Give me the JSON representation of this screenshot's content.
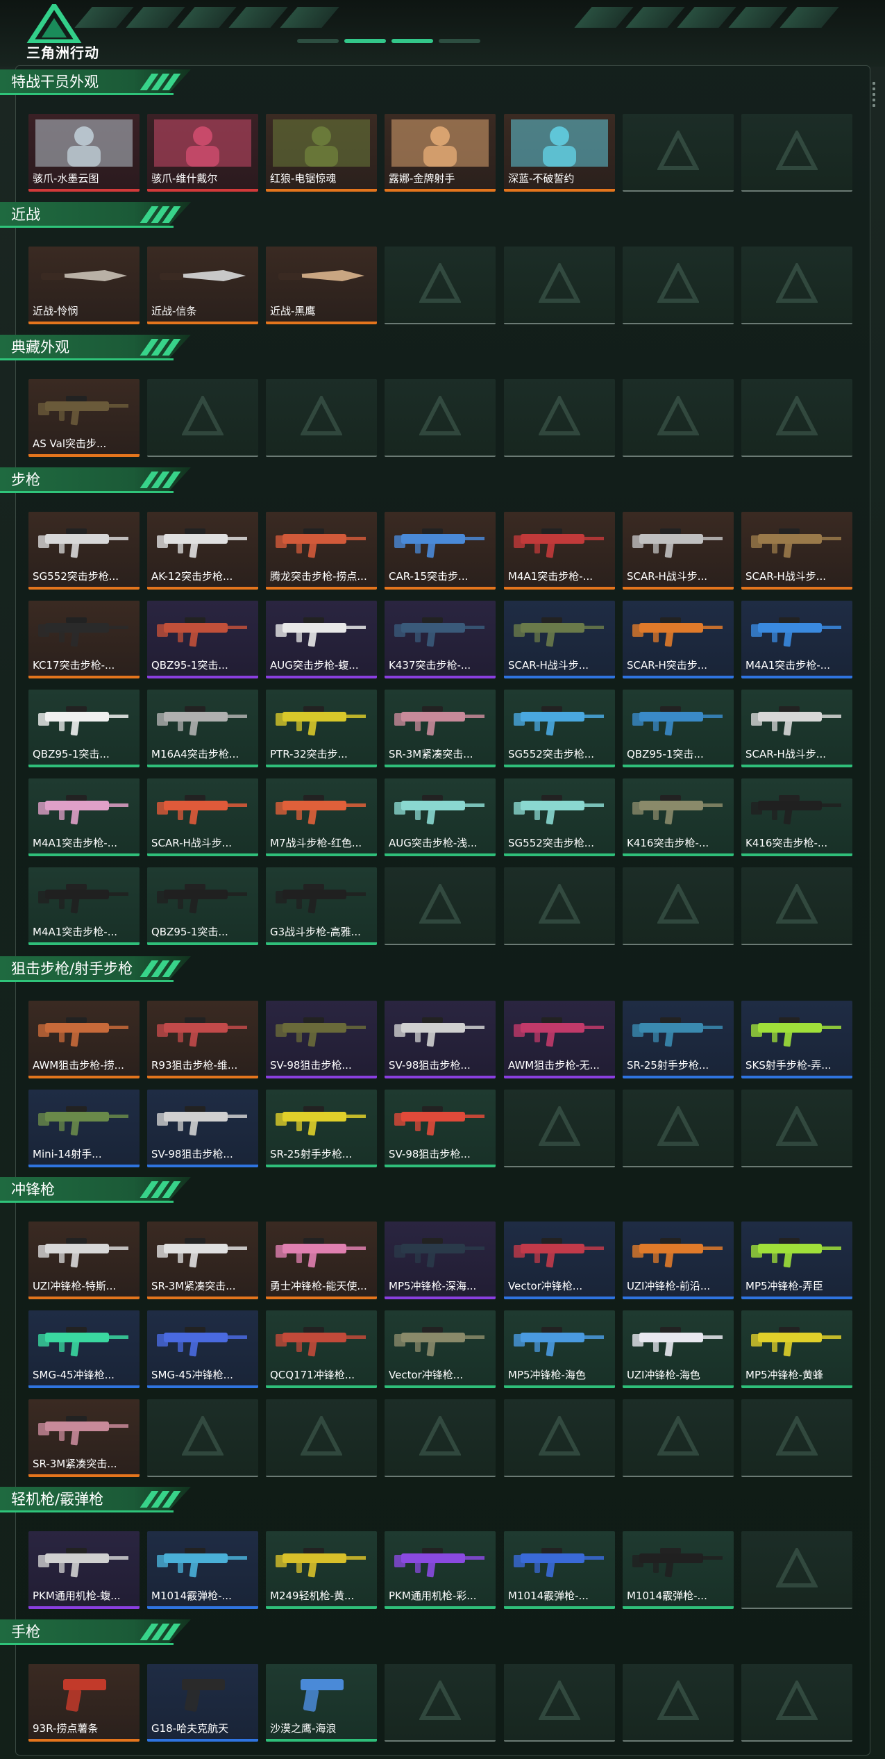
{
  "app": {
    "brand": "三角洲行动"
  },
  "icons": {
    "logo": "delta-logo-icon",
    "placeholder": "delta-watermark-icon"
  },
  "colors": {
    "orange": "#e4751d",
    "red": "#d23a3a",
    "purple": "#8a3fe0",
    "blue": "#2f74e0",
    "green": "#2fbf7a",
    "accent": "#2fc47a"
  },
  "sections": [
    {
      "title": "特战干员外观",
      "rows": 1,
      "items": [
        {
          "label": "骇爪-水墨云图",
          "rarity": "red",
          "kind": "operator",
          "tint": "#b7c3cc"
        },
        {
          "label": "骇爪-维什戴尔",
          "rarity": "red",
          "kind": "operator",
          "tint": "#c84a6a"
        },
        {
          "label": "红狼-电锯惊魂",
          "rarity": "orange",
          "kind": "operator",
          "tint": "#6a7a3a"
        },
        {
          "label": "露娜-金牌射手",
          "rarity": "orange",
          "kind": "operator",
          "tint": "#d9a370"
        },
        {
          "label": "深蓝-不破誓约",
          "rarity": "orange",
          "kind": "operator",
          "tint": "#5fc6d8"
        }
      ]
    },
    {
      "title": "近战",
      "rows": 1,
      "items": [
        {
          "label": "近战-怜悯",
          "rarity": "orange",
          "kind": "melee",
          "tint": "#b9b1a6"
        },
        {
          "label": "近战-信条",
          "rarity": "orange",
          "kind": "melee",
          "tint": "#c8c8c8"
        },
        {
          "label": "近战-黑鹰",
          "rarity": "orange",
          "kind": "melee",
          "tint": "#c9a682"
        }
      ]
    },
    {
      "title": "典藏外观",
      "rows": 1,
      "items": [
        {
          "label": "AS Val突击步...",
          "rarity": "orange",
          "kind": "gun",
          "tint": "#6a5a3a"
        }
      ]
    },
    {
      "title": "步枪",
      "rows": 5,
      "items": [
        {
          "label": "SG552突击步枪...",
          "rarity": "orange",
          "kind": "gun",
          "tint": "#d8d8d8"
        },
        {
          "label": "AK-12突击步枪...",
          "rarity": "orange",
          "kind": "gun",
          "tint": "#e0e0e0"
        },
        {
          "label": "腾龙突击步枪-捞点...",
          "rarity": "orange",
          "kind": "gun",
          "tint": "#d25a3a"
        },
        {
          "label": "CAR-15突击步...",
          "rarity": "orange",
          "kind": "gun",
          "tint": "#4a8ad8"
        },
        {
          "label": "M4A1突击步枪-...",
          "rarity": "orange",
          "kind": "gun",
          "tint": "#c23a3a"
        },
        {
          "label": "SCAR-H战斗步...",
          "rarity": "orange",
          "kind": "gun",
          "tint": "#c0c0c0"
        },
        {
          "label": "SCAR-H战斗步...",
          "rarity": "orange",
          "kind": "gun",
          "tint": "#9a7a4a"
        },
        {
          "label": "KC17突击步枪-...",
          "rarity": "orange",
          "kind": "gun",
          "tint": "#2a2a2a"
        },
        {
          "label": "QBZ95-1突击...",
          "rarity": "purple",
          "kind": "gun",
          "tint": "#c2503a"
        },
        {
          "label": "AUG突击步枪-蝮...",
          "rarity": "purple",
          "kind": "gun",
          "tint": "#e8e8e8"
        },
        {
          "label": "K437突击步枪-...",
          "rarity": "purple",
          "kind": "gun",
          "tint": "#3a5a7a"
        },
        {
          "label": "SCAR-H战斗步...",
          "rarity": "blue",
          "kind": "gun",
          "tint": "#6a7a4a"
        },
        {
          "label": "SCAR-H突击步...",
          "rarity": "blue",
          "kind": "gun",
          "tint": "#e07a2a"
        },
        {
          "label": "M4A1突击步枪-...",
          "rarity": "blue",
          "kind": "gun",
          "tint": "#3a8ae0"
        },
        {
          "label": "QBZ95-1突击...",
          "rarity": "green",
          "kind": "gun",
          "tint": "#f0f0f0"
        },
        {
          "label": "M16A4突击步枪...",
          "rarity": "green",
          "kind": "gun",
          "tint": "#b0b0b0"
        },
        {
          "label": "PTR-32突击步...",
          "rarity": "green",
          "kind": "gun",
          "tint": "#d8c82a"
        },
        {
          "label": "SR-3M紧凑突击...",
          "rarity": "green",
          "kind": "gun",
          "tint": "#c88a9a"
        },
        {
          "label": "SG552突击步枪...",
          "rarity": "green",
          "kind": "gun",
          "tint": "#4aa8e0"
        },
        {
          "label": "QBZ95-1突击...",
          "rarity": "green",
          "kind": "gun",
          "tint": "#3a8ac8"
        },
        {
          "label": "SCAR-H战斗步...",
          "rarity": "green",
          "kind": "gun",
          "tint": "#d8d8d8"
        },
        {
          "label": "M4A1突击步枪-...",
          "rarity": "green",
          "kind": "gun",
          "tint": "#e0a0c8"
        },
        {
          "label": "SCAR-H战斗步...",
          "rarity": "green",
          "kind": "gun",
          "tint": "#e05a3a"
        },
        {
          "label": "M7战斗步枪-红色...",
          "rarity": "green",
          "kind": "gun",
          "tint": "#e0603a"
        },
        {
          "label": "AUG突击步枪-浅...",
          "rarity": "green",
          "kind": "gun",
          "tint": "#8ad8d0"
        },
        {
          "label": "SG552突击步枪...",
          "rarity": "green",
          "kind": "gun",
          "tint": "#8ad8d0"
        },
        {
          "label": "K416突击步枪-...",
          "rarity": "green",
          "kind": "gun",
          "tint": "#8a8a6a"
        },
        {
          "label": "K416突击步枪-...",
          "rarity": "green",
          "kind": "gun",
          "tint": "#202020"
        },
        {
          "label": "M4A1突击步枪-...",
          "rarity": "green",
          "kind": "gun",
          "tint": "#202020"
        },
        {
          "label": "QBZ95-1突击...",
          "rarity": "green",
          "kind": "gun",
          "tint": "#202020"
        },
        {
          "label": "G3战斗步枪-高雅...",
          "rarity": "green",
          "kind": "gun",
          "tint": "#202020"
        }
      ]
    },
    {
      "title": "狙击步枪/射手步枪",
      "rows": 2,
      "items": [
        {
          "label": "AWM狙击步枪-捞...",
          "rarity": "orange",
          "kind": "gun",
          "tint": "#c86a3a"
        },
        {
          "label": "R93狙击步枪-维...",
          "rarity": "orange",
          "kind": "gun",
          "tint": "#c24a4a"
        },
        {
          "label": "SV-98狙击步枪...",
          "rarity": "purple",
          "kind": "gun",
          "tint": "#6a6a3a"
        },
        {
          "label": "SV-98狙击步枪...",
          "rarity": "purple",
          "kind": "gun",
          "tint": "#d0d0d0"
        },
        {
          "label": "AWM狙击步枪-无...",
          "rarity": "purple",
          "kind": "gun",
          "tint": "#c23a6a"
        },
        {
          "label": "SR-25射手步枪...",
          "rarity": "blue",
          "kind": "gun",
          "tint": "#3a8ab0"
        },
        {
          "label": "SKS射手步枪-弄...",
          "rarity": "blue",
          "kind": "gun",
          "tint": "#a0e03a"
        },
        {
          "label": "Mini-14射手...",
          "rarity": "blue",
          "kind": "gun",
          "tint": "#6a8a4a"
        },
        {
          "label": "SV-98狙击步枪...",
          "rarity": "blue",
          "kind": "gun",
          "tint": "#d0d0d0"
        },
        {
          "label": "SR-25射手步枪...",
          "rarity": "green",
          "kind": "gun",
          "tint": "#e0d02a"
        },
        {
          "label": "SV-98狙击步枪...",
          "rarity": "green",
          "kind": "gun",
          "tint": "#e04a3a"
        }
      ]
    },
    {
      "title": "冲锋枪",
      "rows": 3,
      "items": [
        {
          "label": "UZI冲锋枪-特斯...",
          "rarity": "orange",
          "kind": "gun",
          "tint": "#d8d8d8"
        },
        {
          "label": "SR-3M紧凑突击...",
          "rarity": "orange",
          "kind": "gun",
          "tint": "#e0e0e0"
        },
        {
          "label": "勇士冲锋枪-能天使...",
          "rarity": "orange",
          "kind": "gun",
          "tint": "#e080b0"
        },
        {
          "label": "MP5冲锋枪-深海...",
          "rarity": "purple",
          "kind": "gun",
          "tint": "#2a3a4a"
        },
        {
          "label": "Vector冲锋枪...",
          "rarity": "blue",
          "kind": "gun",
          "tint": "#c23a4a"
        },
        {
          "label": "UZI冲锋枪-前沿...",
          "rarity": "blue",
          "kind": "gun",
          "tint": "#e07a2a"
        },
        {
          "label": "MP5冲锋枪-弄臣",
          "rarity": "blue",
          "kind": "gun",
          "tint": "#a0e03a"
        },
        {
          "label": "SMG-45冲锋枪...",
          "rarity": "blue",
          "kind": "gun",
          "tint": "#3ad8a0"
        },
        {
          "label": "SMG-45冲锋枪...",
          "rarity": "blue",
          "kind": "gun",
          "tint": "#4a6ae0"
        },
        {
          "label": "QCQ171冲锋枪...",
          "rarity": "green",
          "kind": "gun",
          "tint": "#c24a3a"
        },
        {
          "label": "Vector冲锋枪...",
          "rarity": "green",
          "kind": "gun",
          "tint": "#8a8a6a"
        },
        {
          "label": "MP5冲锋枪-海色",
          "rarity": "green",
          "kind": "gun",
          "tint": "#4a9ae0"
        },
        {
          "label": "UZI冲锋枪-海色",
          "rarity": "green",
          "kind": "gun",
          "tint": "#e8e8f0"
        },
        {
          "label": "MP5冲锋枪-黄蜂",
          "rarity": "green",
          "kind": "gun",
          "tint": "#e0d02a"
        },
        {
          "label": "SR-3M紧凑突击...",
          "rarity": "orange",
          "kind": "gun",
          "tint": "#c88a9a"
        }
      ]
    },
    {
      "title": "轻机枪/霰弹枪",
      "rows": 1,
      "items": [
        {
          "label": "PKM通用机枪-蝮...",
          "rarity": "purple",
          "kind": "gun",
          "tint": "#d0d0d0"
        },
        {
          "label": "M1014霰弹枪-...",
          "rarity": "blue",
          "kind": "gun",
          "tint": "#4ab0d8"
        },
        {
          "label": "M249轻机枪-黄...",
          "rarity": "green",
          "kind": "gun",
          "tint": "#d8c02a"
        },
        {
          "label": "PKM通用机枪-彩...",
          "rarity": "green",
          "kind": "gun",
          "tint": "#8a4ae0"
        },
        {
          "label": "M1014霰弹枪-...",
          "rarity": "green",
          "kind": "gun",
          "tint": "#3a6ad8"
        },
        {
          "label": "M1014霰弹枪-...",
          "rarity": "green",
          "kind": "gun",
          "tint": "#202020"
        }
      ]
    },
    {
      "title": "手枪",
      "rows": 1,
      "items": [
        {
          "label": "93R-捞点薯条",
          "rarity": "orange",
          "kind": "pistol",
          "tint": "#c23a2a"
        },
        {
          "label": "G18-哈夫克航天",
          "rarity": "blue",
          "kind": "pistol",
          "tint": "#2a2a2a"
        },
        {
          "label": "沙漠之鹰-海浪",
          "rarity": "green",
          "kind": "pistol",
          "tint": "#4a8ad8"
        }
      ]
    }
  ]
}
